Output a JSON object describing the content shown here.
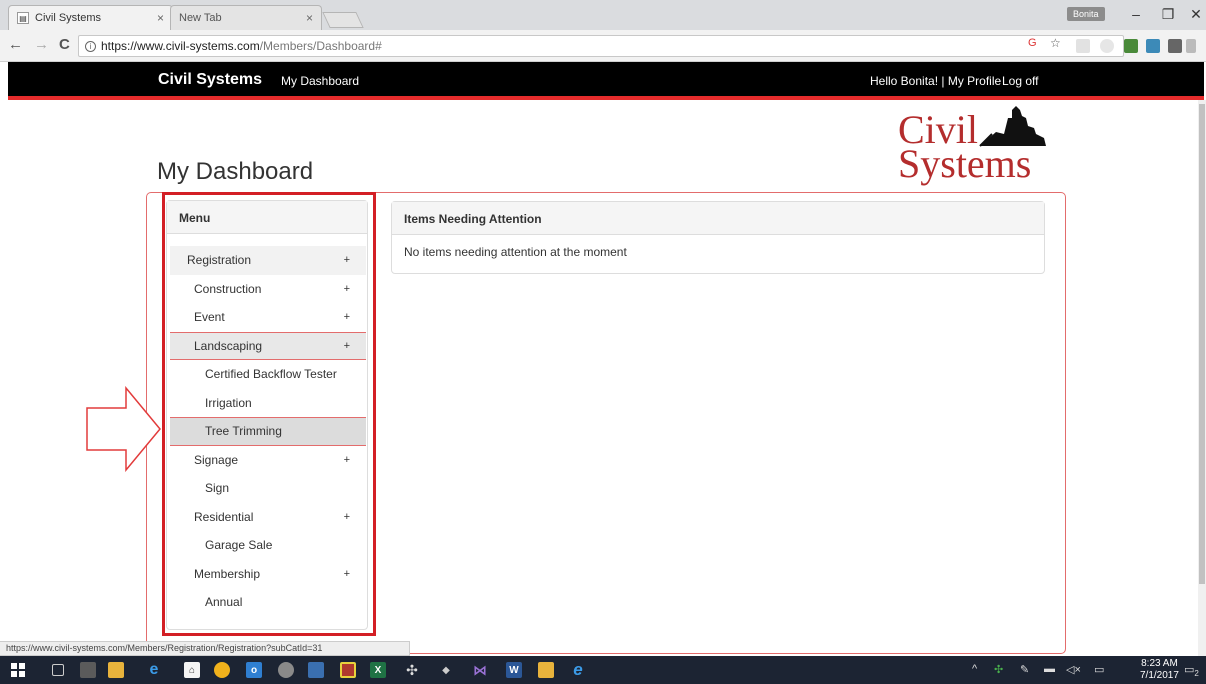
{
  "browser": {
    "tabs": [
      {
        "title": "Civil Systems",
        "close": "×"
      },
      {
        "title": "New Tab",
        "close": "×"
      }
    ],
    "user_badge": "Bonita",
    "window_controls": {
      "minimize": "–",
      "restore": "❐",
      "close": "✕"
    },
    "nav": {
      "back": "←",
      "forward": "→",
      "reload": "C"
    },
    "url_host": "https://www.civil-systems.com",
    "url_path": "/Members/Dashboard#",
    "status_url": "https://www.civil-systems.com/Members/Registration/Registration?subCatId=31"
  },
  "site": {
    "brand": "Civil Systems",
    "nav_dashboard": "My Dashboard",
    "greeting": "Hello Bonita! | My Profile",
    "logoff": "Log off",
    "logo_line1": "Civil",
    "logo_line2": "Systems"
  },
  "page_title": "My Dashboard",
  "menu": {
    "header": "Menu",
    "items": [
      {
        "label": "Registration",
        "plus": "+"
      },
      {
        "label": "Construction",
        "plus": "+"
      },
      {
        "label": "Event",
        "plus": "+"
      },
      {
        "label": "Landscaping",
        "plus": "+"
      },
      {
        "label": "Certified Backflow Tester"
      },
      {
        "label": "Irrigation"
      },
      {
        "label": "Tree Trimming"
      },
      {
        "label": "Signage",
        "plus": "+"
      },
      {
        "label": "Sign"
      },
      {
        "label": "Residential",
        "plus": "+"
      },
      {
        "label": "Garage Sale"
      },
      {
        "label": "Membership",
        "plus": "+"
      },
      {
        "label": "Annual"
      }
    ]
  },
  "attention": {
    "header": "Items Needing Attention",
    "body": "No items needing attention at the moment"
  },
  "taskbar": {
    "time": "8:23 AM",
    "date": "7/1/2017",
    "notifications": "2"
  },
  "colors": {
    "accent_red": "#e52b2b",
    "highlight_box": "#d31f25",
    "logo_red": "#b42d2d"
  }
}
